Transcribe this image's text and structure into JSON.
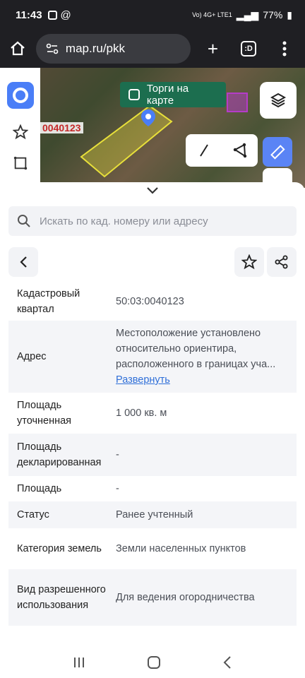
{
  "status_bar": {
    "time": "11:43",
    "signal_text": "Vo) 4G+ LTE1",
    "battery": "77%"
  },
  "browser": {
    "url": "map.ru/pkk",
    "tabs_label": ":D",
    "add_tab": "+"
  },
  "map": {
    "parcel_label": "0040123",
    "auction_toggle_label": "Торги на карте"
  },
  "sheet": {
    "search_placeholder": "Искать по кад. номеру или адресу",
    "rows": [
      {
        "key": "Кадастровый квартал",
        "value": "50:03:0040123"
      },
      {
        "key": "Адрес",
        "value": "Местоположение установлено относительно ориентира, расположенного в границах уча...",
        "link": "Развернуть"
      },
      {
        "key": "Площадь уточненная",
        "value": "1 000 кв. м"
      },
      {
        "key": "Площадь декларированная",
        "value": "-"
      },
      {
        "key": "Площадь",
        "value": "-"
      },
      {
        "key": "Статус",
        "value": "Ранее учтенный"
      },
      {
        "key": "Категория земель",
        "value": "Земли населенных пунктов"
      },
      {
        "key": "Вид разрешенного использования",
        "value": "Для ведения огородничества"
      }
    ]
  },
  "colors": {
    "accent": "#4a7ef7",
    "auction_chip": "#1c6e4f",
    "parcel_outline": "#e8e03a",
    "link": "#2f6fd8"
  }
}
